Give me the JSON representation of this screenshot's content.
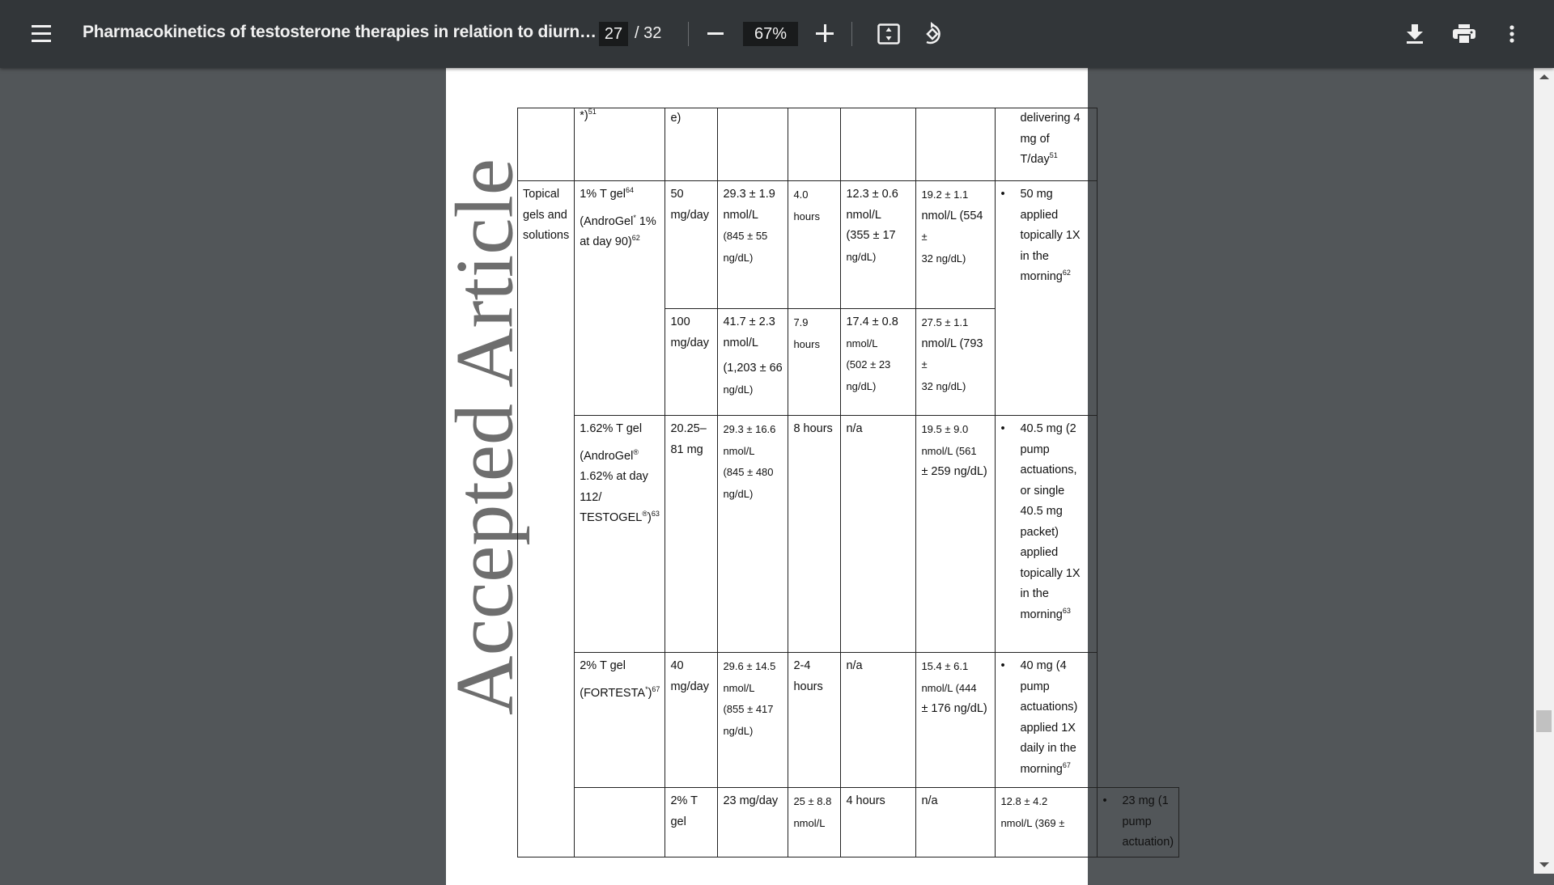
{
  "toolbar": {
    "title": "Pharmacokinetics of testosterone therapies in relation to diurn…",
    "current_page": "27",
    "page_total": "/ 32",
    "zoom": "67%",
    "icons": [
      "menu-icon",
      "zoom-out-icon",
      "zoom-in-icon",
      "fit-page-icon",
      "rotate-icon",
      "download-icon",
      "print-icon",
      "more-icon"
    ]
  },
  "watermark": "Accepted Article",
  "table": {
    "rows": [
      {
        "category": "",
        "product": [
          "*)",
          "51"
        ],
        "dose": "e)",
        "cmax": [],
        "tmax": "",
        "cmin": [],
        "cavg": [],
        "regimen": {
          "bullet": false,
          "lines": [
            "delivering 4",
            "mg of",
            "T/day"
          ],
          "ref": "51"
        }
      },
      {
        "category": "Topical gels and solutions",
        "product": [
          "1% T gel",
          "64",
          "(AndroGel",
          "*",
          " 1% at day 90)",
          "62"
        ],
        "dose": "50 mg/day",
        "cmax": [
          "29.3 ± 1.9",
          "nmol/L",
          "(845 ± 55",
          "ng/dL)"
        ],
        "tmax": "4.0 hours",
        "cmin": [
          "12.3 ± 0.6",
          "nmol/L",
          "(355 ± 17",
          "ng/dL)"
        ],
        "cavg": [
          "19.2 ± 1.1",
          "nmol/L (554",
          "±",
          "32 ng/dL)"
        ],
        "regimen": {
          "bullet": true,
          "lines": [
            "50 mg",
            "applied",
            "topically 1X",
            "in the",
            "morning"
          ],
          "ref": "62"
        }
      },
      {
        "dose": "100 mg/day",
        "cmax": [
          "41.7 ± 2.3",
          "nmol/L",
          "(1,203 ± 66",
          "ng/dL)"
        ],
        "tmax": "7.9 hours",
        "cmin": [
          "17.4 ± 0.8",
          "nmol/L",
          "(502 ± 23",
          "ng/dL)"
        ],
        "cavg": [
          "27.5 ± 1.1",
          "nmol/L (793",
          "±",
          "32 ng/dL)"
        ]
      },
      {
        "product": [
          "1.62% T gel",
          "(AndroGel",
          "®",
          " 1.62% at day 112/ TESTOGEL",
          "®",
          ")",
          "63"
        ],
        "dose": "20.25–81 mg",
        "cmax": [
          "29.3 ± 16.6",
          "nmol/L",
          "(845 ± 480",
          "ng/dL)"
        ],
        "tmax": "8 hours",
        "cmin": "n/a",
        "cavg": [
          "19.5 ± 9.0",
          "nmol/L (561",
          "± 259 ng/dL)"
        ],
        "regimen": {
          "bullet": true,
          "lines": [
            "40.5 mg (2",
            "pump",
            "actuations,",
            "or single",
            "40.5 mg",
            "packet)",
            "applied",
            "topically 1X",
            "in the",
            "morning"
          ],
          "ref": "63"
        }
      },
      {
        "product": [
          "2% T gel",
          "(FORTESTA",
          "*",
          ")",
          "67"
        ],
        "dose": "40 mg/day",
        "cmax": [
          "29.6 ± 14.5",
          "nmol/L",
          "(855 ± 417",
          "ng/dL)"
        ],
        "tmax": "2-4 hours",
        "cmin": "n/a",
        "cavg": [
          "15.4 ± 6.1",
          "nmol/L (444",
          "± 176 ng/dL)"
        ],
        "regimen": {
          "bullet": true,
          "lines": [
            "40 mg (4",
            "pump",
            "actuations)",
            "applied 1X",
            "daily in the",
            "morning"
          ],
          "ref": "67"
        }
      },
      {
        "product": [
          "2% T gel"
        ],
        "dose": "23 mg/day",
        "cmax": [
          "25 ± 8.8",
          "nmol/L"
        ],
        "tmax": "4 hours",
        "cmin": "n/a",
        "cavg": [
          "12.8 ± 4.2",
          "nmol/L (369 ±"
        ],
        "regimen": {
          "bullet": true,
          "lines": [
            "23 mg (1",
            "pump",
            "actuation)"
          ],
          "ref": ""
        }
      }
    ]
  },
  "scrollbar": {
    "position_fraction": 0.8
  }
}
